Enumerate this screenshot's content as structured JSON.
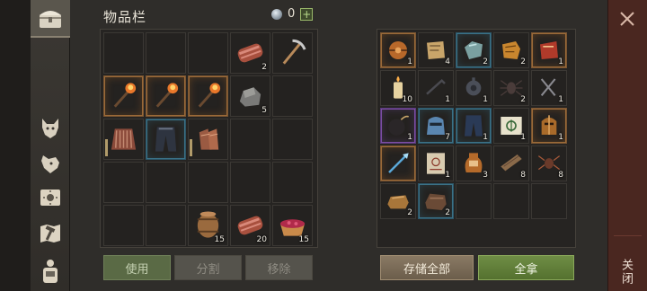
{
  "inventory": {
    "title": "物品栏",
    "currency_count": "0",
    "add_label": "+",
    "slots": [
      {
        "icon": "empty"
      },
      {
        "icon": "empty"
      },
      {
        "icon": "empty"
      },
      {
        "icon": "meat-icon",
        "qty": "2"
      },
      {
        "icon": "pickaxe-icon"
      },
      {
        "icon": "torch-icon",
        "rarity": "orange"
      },
      {
        "icon": "torch-icon",
        "rarity": "orange"
      },
      {
        "icon": "torch-icon",
        "rarity": "orange"
      },
      {
        "icon": "stone-icon",
        "qty": "5"
      },
      {
        "icon": "empty"
      },
      {
        "icon": "jacket-icon",
        "durability": true
      },
      {
        "icon": "pants-icon",
        "rarity": "blue"
      },
      {
        "icon": "gloves-icon",
        "durability": true
      },
      {
        "icon": "empty"
      },
      {
        "icon": "empty"
      },
      {
        "icon": "empty"
      },
      {
        "icon": "empty"
      },
      {
        "icon": "empty"
      },
      {
        "icon": "empty"
      },
      {
        "icon": "empty"
      },
      {
        "icon": "empty"
      },
      {
        "icon": "empty"
      },
      {
        "icon": "barrel-icon",
        "qty": "15"
      },
      {
        "icon": "meat-icon",
        "qty": "20"
      },
      {
        "icon": "berry-bowl-icon",
        "qty": "15"
      }
    ],
    "buttons": {
      "use": "使用",
      "split": "分割",
      "remove": "移除"
    }
  },
  "container": {
    "slots": [
      {
        "icon": "helmet-orb-icon",
        "rarity": "orange",
        "qty": "1"
      },
      {
        "icon": "map-scrap-icon",
        "qty": "4"
      },
      {
        "icon": "herb-chunk-icon",
        "rarity": "blue",
        "qty": "2"
      },
      {
        "icon": "scroll-piece-icon",
        "qty": "2"
      },
      {
        "icon": "red-book-icon",
        "rarity": "orange",
        "qty": "1"
      },
      {
        "icon": "candle-icon",
        "qty": "10"
      },
      {
        "icon": "crowbar-icon",
        "qty": "1"
      },
      {
        "icon": "gear-part-icon",
        "qty": "1"
      },
      {
        "icon": "spider-icon",
        "qty": "2"
      },
      {
        "icon": "scissors-icon",
        "qty": "1"
      },
      {
        "icon": "bomb-icon",
        "rarity": "purple",
        "qty": "1"
      },
      {
        "icon": "blue-helmet-icon",
        "rarity": "blue",
        "qty": "7"
      },
      {
        "icon": "blue-pants-icon",
        "rarity": "blue",
        "qty": "1"
      },
      {
        "icon": "blueprint-icon",
        "qty": "1"
      },
      {
        "icon": "knight-helmet-icon",
        "rarity": "orange",
        "qty": "1"
      },
      {
        "icon": "ice-spear-icon",
        "rarity": "orange"
      },
      {
        "icon": "recipe-scroll-icon",
        "qty": "1"
      },
      {
        "icon": "jug-icon",
        "qty": "3"
      },
      {
        "icon": "plank-icon",
        "qty": "8"
      },
      {
        "icon": "spider-brown-icon",
        "qty": "8"
      },
      {
        "icon": "bread-icon",
        "qty": "2"
      },
      {
        "icon": "dark-loaf-icon",
        "rarity": "blue",
        "qty": "2"
      },
      {
        "icon": "empty"
      },
      {
        "icon": "empty"
      },
      {
        "icon": "empty"
      }
    ],
    "buttons": {
      "store_all": "存储全部",
      "take_all": "全拿"
    }
  },
  "close": {
    "label": "关闭"
  },
  "tabs": [
    "chest-icon",
    "wolf-head-icon",
    "dog-head-icon",
    "sun-scroll-icon",
    "map-hammer-icon",
    "backpack-person-icon"
  ]
}
